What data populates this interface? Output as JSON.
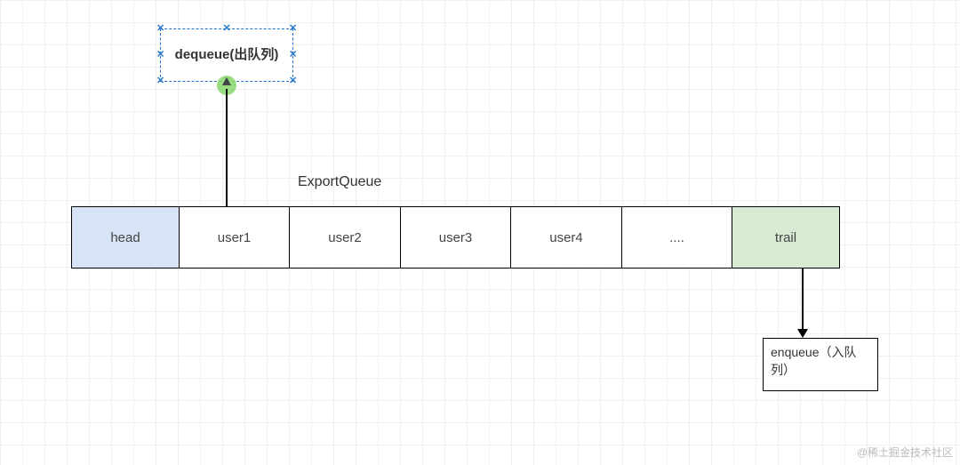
{
  "title": "ExportQueue",
  "queue": {
    "head_label": "head",
    "trail_label": "trail",
    "cells": [
      "user1",
      "user2",
      "user3",
      "user4",
      "...."
    ]
  },
  "dequeue": {
    "label": "dequeue(出队列)"
  },
  "enqueue": {
    "label": "enqueue（入队列）"
  },
  "watermark": "@稀土掘金技术社区"
}
